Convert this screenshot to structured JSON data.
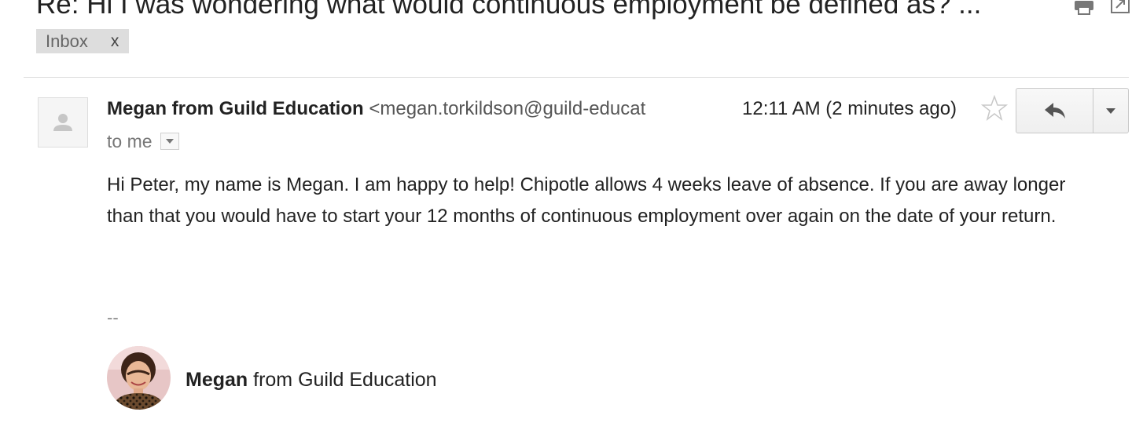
{
  "thread": {
    "subject": "Re: Hi I was wondering what would continuous employment be defined as? ...",
    "labels": [
      {
        "name": "Inbox",
        "remove": "x"
      }
    ]
  },
  "message": {
    "sender_name": "Megan from Guild Education",
    "sender_email": "<megan.torkildson@guild-educat",
    "recipient": "to me",
    "timestamp": "12:11 AM (2 minutes ago)",
    "body": "Hi Peter, my name is Megan. I am happy to help! Chipotle allows 4 weeks leave of absence. If you are away longer than that you would have to start your 12 months of continuous employment over again on the date of your return.",
    "signature": {
      "separator": "--",
      "name": "Megan",
      "org": " from Guild Education"
    }
  },
  "icons": {
    "print": "print-icon",
    "new_window": "new-window-icon",
    "avatar": "person-icon",
    "star": "star-icon",
    "reply": "reply-icon",
    "more": "chevron-down-icon",
    "details": "dropdown-arrow-icon"
  },
  "colors": {
    "label_bg": "#dddddd",
    "divider": "#dcdcdc",
    "secondary_text": "#777777"
  }
}
